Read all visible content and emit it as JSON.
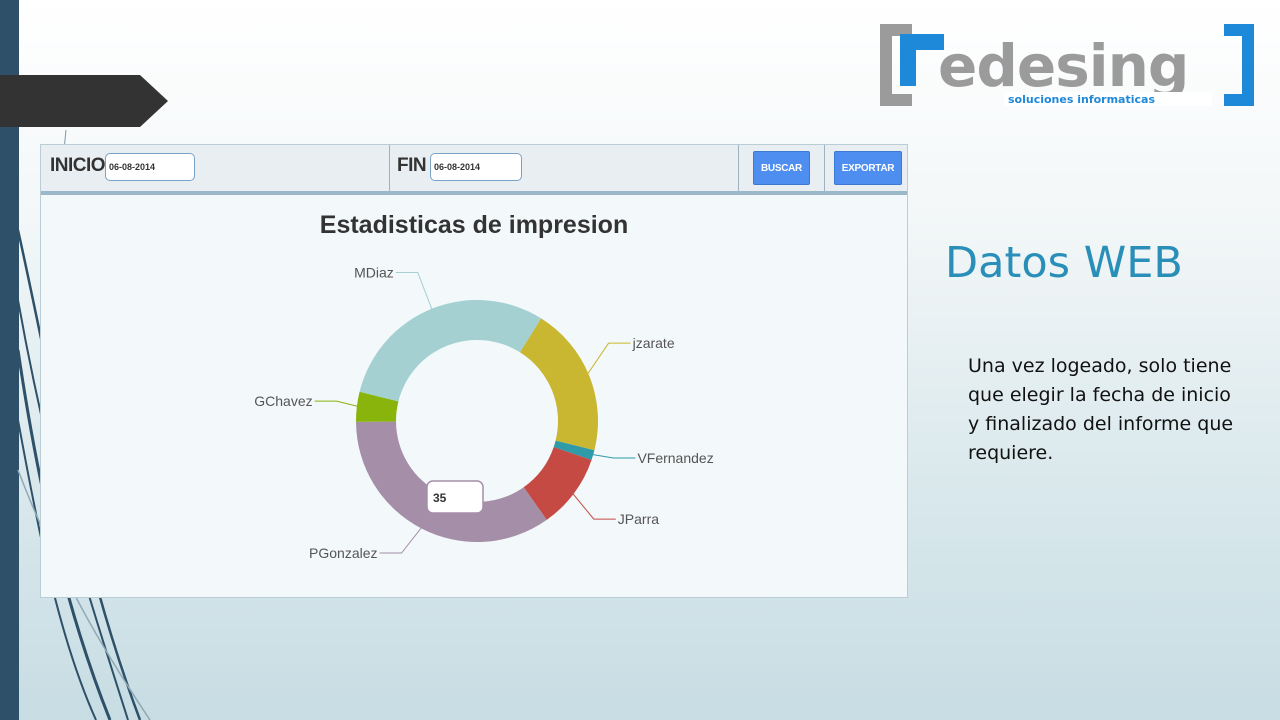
{
  "logo": {
    "text": "edesing",
    "subtitle": "soluciones informaticas"
  },
  "toolbar": {
    "inicio_label": "INICIO",
    "inicio_value": "06-08-2014",
    "fin_label": "FIN",
    "fin_value": "06-08-2014",
    "buscar_label": "BUSCAR",
    "exportar_label": "EXPORTAR"
  },
  "chart_data": {
    "type": "pie",
    "title": "Estadisticas de impresion",
    "donut": true,
    "slices": [
      {
        "label": "jzarate",
        "value": 30,
        "color": "#c9b731"
      },
      {
        "label": "VFernandez",
        "value": 2,
        "color": "#2f9aa8"
      },
      {
        "label": "JParra",
        "value": 15,
        "color": "#c44a43"
      },
      {
        "label": "PGonzalez",
        "value": 52,
        "color": "#a58ea8"
      },
      {
        "label": "GChavez",
        "value": 6,
        "color": "#88b40c"
      },
      {
        "label": "MDiaz",
        "value": 45,
        "color": "#a4d0d1"
      }
    ],
    "tooltip": "35"
  },
  "side": {
    "title": "Datos WEB",
    "text": "Una vez logeado, solo tiene que elegir la fecha de inicio y finalizado del informe que requiere."
  },
  "colors": {
    "accent": "#2a8fb8",
    "button": "#4d8ef0",
    "sidebar": "#2e5068"
  }
}
